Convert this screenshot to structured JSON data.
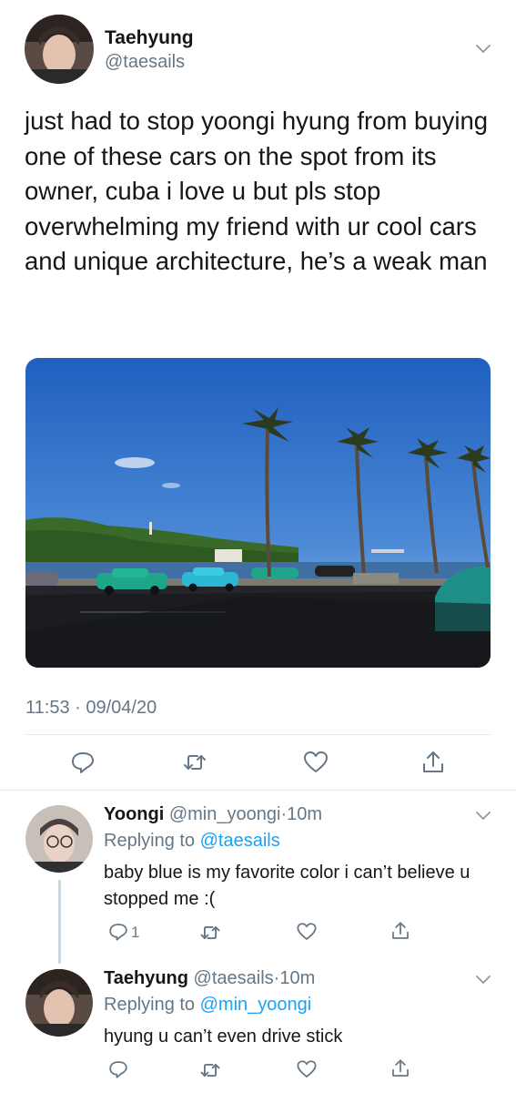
{
  "main_tweet": {
    "author_name": "Taehyung",
    "author_handle": "@taesails",
    "text": "just had to stop yoongi hyung from buying one of these cars on the spot from its owner, cuba i love u but pls stop overwhelming my friend with ur cool cars and unique architecture, he’s a weak man",
    "timestamp": "11:53 · 09/04/20",
    "actions": [
      "reply-icon",
      "retweet-icon",
      "like-icon",
      "share-icon"
    ]
  },
  "replies": [
    {
      "author_name": "Yoongi",
      "author_handle": "@min_yoongi",
      "time_sep": "·",
      "time": "10m",
      "replying_label": "Replying to",
      "replying_handle": "@taesails",
      "text": "baby blue is my favorite color i can’t believe u stopped me :(",
      "reply_count": "1"
    },
    {
      "author_name": "Taehyung",
      "author_handle": "@taesails",
      "time_sep": "·",
      "time": "10m",
      "replying_label": "Replying to",
      "replying_handle": "@min_yoongi",
      "text": "hyung u can’t even drive stick",
      "reply_count": ""
    }
  ],
  "colors": {
    "link": "#1da1f2",
    "muted": "#657786",
    "divider": "#e1e8ed"
  }
}
